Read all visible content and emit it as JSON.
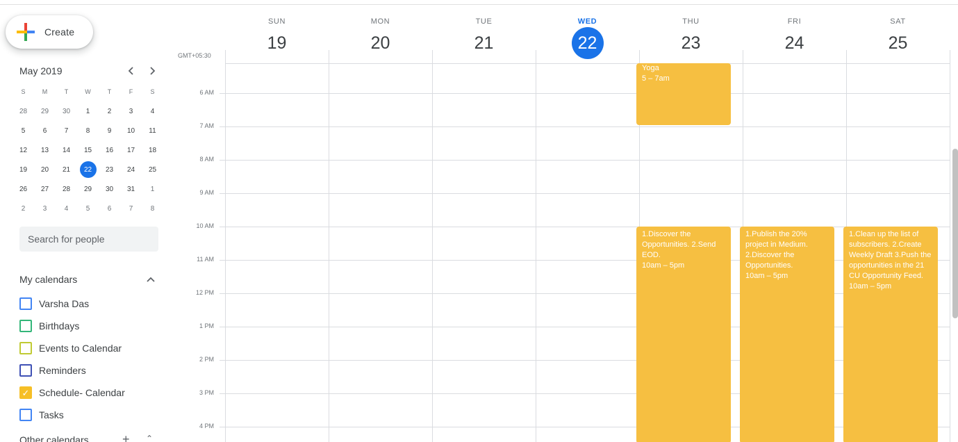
{
  "create": {
    "label": "Create"
  },
  "mini_calendar": {
    "title": "May 2019",
    "prev_icon": "chevron-left-icon",
    "next_icon": "chevron-right-icon",
    "weekday_heads": [
      "S",
      "M",
      "T",
      "W",
      "T",
      "F",
      "S"
    ],
    "weeks": [
      [
        "28",
        "29",
        "30",
        "1",
        "2",
        "3",
        "4"
      ],
      [
        "5",
        "6",
        "7",
        "8",
        "9",
        "10",
        "11"
      ],
      [
        "12",
        "13",
        "14",
        "15",
        "16",
        "17",
        "18"
      ],
      [
        "19",
        "20",
        "21",
        "22",
        "23",
        "24",
        "25"
      ],
      [
        "26",
        "27",
        "28",
        "29",
        "30",
        "31",
        "1"
      ],
      [
        "2",
        "3",
        "4",
        "5",
        "6",
        "7",
        "8"
      ]
    ],
    "today": "22"
  },
  "search": {
    "placeholder": "Search for people"
  },
  "my_calendars": {
    "title": "My calendars",
    "items": [
      {
        "name": "Varsha Das",
        "color": "#4285f4",
        "checked": false
      },
      {
        "name": "Birthdays",
        "color": "#33b679",
        "checked": false
      },
      {
        "name": "Events to Calendar",
        "color": "#c0ca33",
        "checked": false
      },
      {
        "name": "Reminders",
        "color": "#3f51b5",
        "checked": false
      },
      {
        "name": "Schedule- Calendar",
        "color": "#f6bf26",
        "checked": true
      },
      {
        "name": "Tasks",
        "color": "#4285f4",
        "checked": false
      }
    ]
  },
  "other_calendars": {
    "title": "Other calendars"
  },
  "timezone": "GMT+05:30",
  "days": [
    {
      "name": "SUN",
      "num": "19",
      "today": false
    },
    {
      "name": "MON",
      "num": "20",
      "today": false
    },
    {
      "name": "TUE",
      "num": "21",
      "today": false
    },
    {
      "name": "WED",
      "num": "22",
      "today": true
    },
    {
      "name": "THU",
      "num": "23",
      "today": false
    },
    {
      "name": "FRI",
      "num": "24",
      "today": false
    },
    {
      "name": "SAT",
      "num": "25",
      "today": false
    }
  ],
  "hours": [
    "6 AM",
    "7 AM",
    "8 AM",
    "9 AM",
    "10 AM",
    "11 AM",
    "12 PM",
    "1 PM",
    "2 PM",
    "3 PM",
    "4 PM"
  ],
  "event_color": "#f6bf41",
  "events": [
    {
      "day": "THU",
      "title": "Yoga",
      "time": "5 – 7am"
    },
    {
      "day": "THU",
      "title": "1.Discover the Opportunities. 2.Send EOD.",
      "time": "10am – 5pm"
    },
    {
      "day": "FRI",
      "title": "1.Publish the 20% project in Medium. 2.Discover the Opportunities.",
      "time": "10am – 5pm"
    },
    {
      "day": "SAT",
      "title": "1.Clean up the list of subscribers. 2.Create Weekly Draft 3.Push the opportunities in the 21 CU Opportunity Feed.",
      "time": "10am – 5pm"
    }
  ]
}
